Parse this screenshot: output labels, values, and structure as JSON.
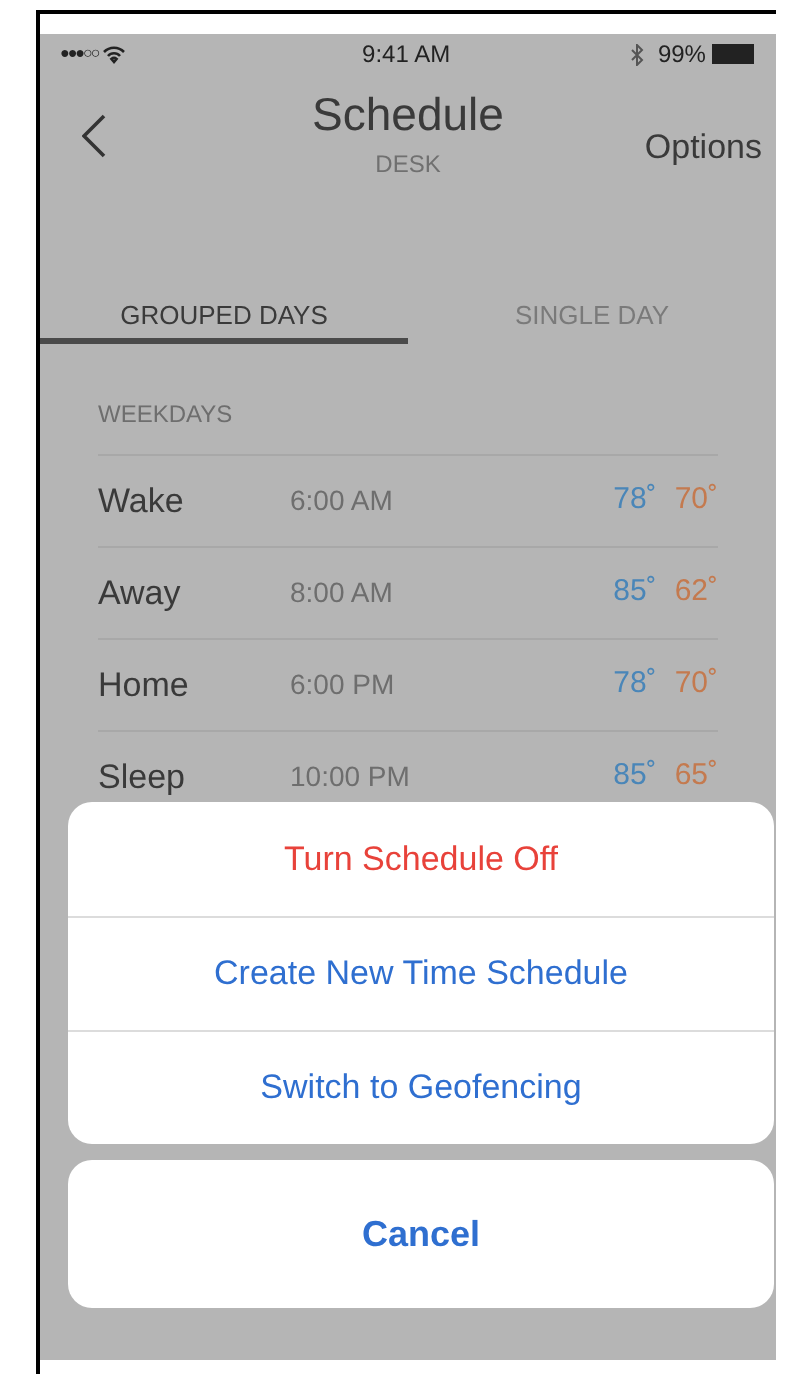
{
  "status_bar": {
    "signal": "●●●○○",
    "time": "9:41 AM",
    "battery": "99%"
  },
  "header": {
    "title": "Schedule",
    "subtitle": "DESK",
    "action": "Options"
  },
  "tabs": [
    {
      "label": "GROUPED DAYS",
      "selected": true
    },
    {
      "label": "SINGLE DAY",
      "selected": false
    }
  ],
  "section": {
    "title": "WEEKDAYS",
    "rows": [
      {
        "period": "Wake",
        "time": "6:00 AM",
        "cool": "78˚",
        "heat": "70˚"
      },
      {
        "period": "Away",
        "time": "8:00 AM",
        "cool": "85˚",
        "heat": "62˚"
      },
      {
        "period": "Home",
        "time": "6:00 PM",
        "cool": "78˚",
        "heat": "70˚"
      },
      {
        "period": "Sleep",
        "time": "10:00 PM",
        "cool": "85˚",
        "heat": "65˚"
      }
    ]
  },
  "action_sheet": {
    "actions": [
      {
        "label": "Turn Schedule Off",
        "kind": "destructive"
      },
      {
        "label": "Create New Time Schedule",
        "kind": "default"
      },
      {
        "label": "Switch to Geofencing",
        "kind": "default"
      }
    ],
    "cancel": "Cancel"
  }
}
